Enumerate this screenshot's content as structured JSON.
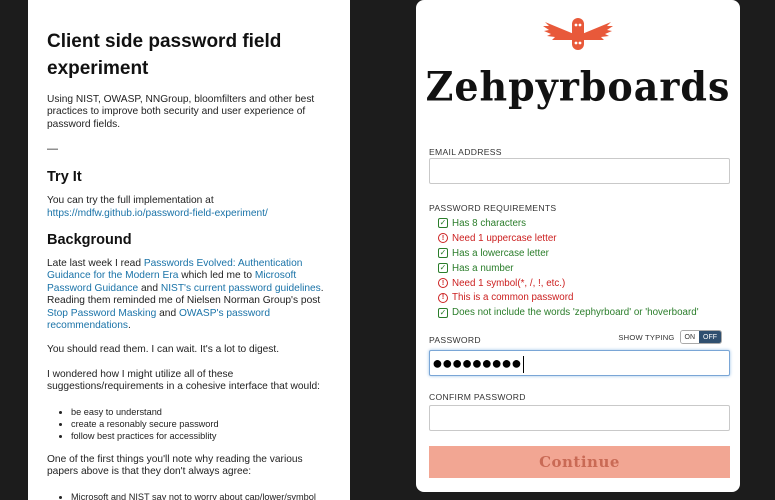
{
  "article": {
    "title": "Client side password field experiment",
    "intro": "Using NIST, OWASP, NNGroup, bloomfilters and other best practices to improve both security and user experience of password fields.",
    "separator": "—",
    "try_heading": "Try It",
    "try_text": "You can try the full implementation at",
    "try_link": "https://mdfw.github.io/password-field-experiment/",
    "background_heading": "Background",
    "bg_p1": {
      "t1": "Late last week I read ",
      "l1": "Passwords Evolved: Authentication Guidance for the Modern Era",
      "t2": " which led me to ",
      "l2": "Microsoft Password Guidance",
      "t3": " and ",
      "l3": "NIST's current password guidelines",
      "t4": ". Reading them reminded me of Nielsen Norman Group's post ",
      "l4": "Stop Password Masking",
      "t5": " and ",
      "l5": "OWASP's password recommendations",
      "t6": "."
    },
    "bg_p2": "You should read them. I can wait. It's a lot to digest.",
    "bg_p3": "I wondered how I might utilize all of these suggestions/requirements in a cohesive interface that would:",
    "bullets": [
      "be easy to understand",
      "create a resonably secure password",
      "follow best practices for accessiblity"
    ],
    "bg_p4": "One of the first things you'll note why reading the various papers above is that they don't always agree:",
    "bullets2": [
      "Microsoft and NIST say not to worry about cap/lower/symbol"
    ]
  },
  "form": {
    "brand": "Zehpyrboards",
    "email_label": "EMAIL ADDRESS",
    "email_value": "",
    "requirements_label": "PASSWORD REQUIREMENTS",
    "requirements": [
      {
        "text": "Has 8 characters",
        "status": "pass"
      },
      {
        "text": "Need 1 uppercase letter",
        "status": "fail"
      },
      {
        "text": "Has a lowercase letter",
        "status": "pass"
      },
      {
        "text": "Has a number",
        "status": "pass"
      },
      {
        "text": "Need 1 symbol(*, /, !, etc.)",
        "status": "fail"
      },
      {
        "text": "This is a common password",
        "status": "fail"
      },
      {
        "text": "Does not include the words 'zephyrboard' or 'hoverboard'",
        "status": "pass"
      }
    ],
    "password_label": "PASSWORD",
    "show_typing_label": "SHOW TYPING",
    "toggle_on": "ON",
    "toggle_off": "OFF",
    "password_value": "●●●●●●●●●",
    "confirm_label": "CONFIRM PASSWORD",
    "confirm_value": "",
    "continue_label": "Continue",
    "colors": {
      "pass": "#2a7d2a",
      "fail": "#cc2020",
      "button": "#f2a693",
      "accent": "#e8593a"
    }
  }
}
